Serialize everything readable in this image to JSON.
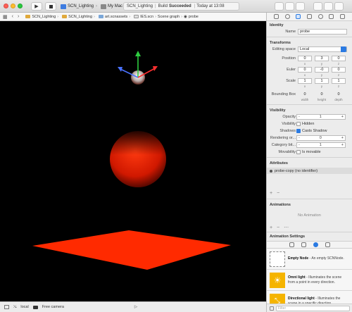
{
  "toolbar": {
    "scheme_name": "SCN_Lighting",
    "destination": "My Mac",
    "status_project": "SCN_Lighting",
    "status_build_prefix": "Build",
    "status_build_result": "Succeeded",
    "status_time": "Today at 13:08"
  },
  "jumpbar": {
    "crumbs": [
      "SCN_Lighting",
      "SCN_Lighting",
      "art.scnassets",
      "IES.scn",
      "Scene graph",
      "probe"
    ]
  },
  "viewport": {
    "light_color": "#ff2a00"
  },
  "bottombar": {
    "space": "local",
    "camera": "Free camera"
  },
  "inspector": {
    "identity_title": "Identity",
    "name_label": "Name",
    "name_value": "probe",
    "transforms_title": "Transforms",
    "editing_space_label": "Editing space",
    "editing_space_value": "Local",
    "position_label": "Position",
    "position": [
      "0",
      "3",
      "0"
    ],
    "euler_label": "Euler",
    "euler": [
      "0",
      "-0",
      "0"
    ],
    "scale_label": "Scale",
    "scale": [
      "1",
      "1",
      "1"
    ],
    "axis_x": "x",
    "axis_y": "y",
    "axis_z": "z",
    "bbox_label": "Bounding Box",
    "bbox": [
      "0",
      "0",
      "0"
    ],
    "bbox_width": "width",
    "bbox_height": "height",
    "bbox_depth": "depth",
    "visibility_title": "Visibility",
    "opacity_label": "Opacity",
    "opacity_value": "1",
    "visibility_label": "Visibility",
    "hidden_label": "Hidden",
    "shadows_label": "Shadows",
    "casts_shadow_label": "Casts Shadow",
    "rendering_label": "Rendering or...",
    "rendering_value": "0",
    "category_label": "Category bit...",
    "category_value": "1",
    "movability_label": "Movability",
    "movable_label": "Is movable",
    "attributes_title": "Attributes",
    "attribute_item": "probe-copy (no identifier)",
    "animations_title": "Animations",
    "no_animation": "No Animation",
    "animation_settings_title": "Animation Settings",
    "filter_placeholder": "Filter"
  },
  "library": [
    {
      "title": "Empty Node",
      "desc": " - An empty SCNNode."
    },
    {
      "title": "Omni light",
      "desc": " - Illuminates the scene from a point in every direction."
    },
    {
      "title": "Directional light",
      "desc": " - Illuminates the scene in a specific direction."
    }
  ]
}
